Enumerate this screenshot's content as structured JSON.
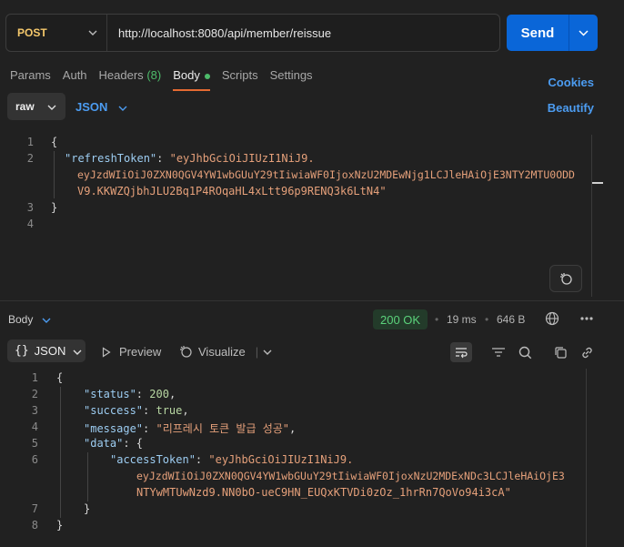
{
  "request": {
    "method": "POST",
    "url": "http://localhost:8080/api/member/reissue",
    "send_label": "Send"
  },
  "tabs": [
    {
      "label": "Params"
    },
    {
      "label": "Auth"
    },
    {
      "label": "Headers",
      "count": "(8)"
    },
    {
      "label": "Body",
      "active": true
    },
    {
      "label": "Scripts"
    },
    {
      "label": "Settings"
    }
  ],
  "links": {
    "cookies": "Cookies",
    "beautify": "Beautify"
  },
  "body_mode": {
    "raw": "raw",
    "json": "JSON"
  },
  "request_body": {
    "line_numbers": [
      "1",
      "2",
      "3",
      "4"
    ],
    "open": "{",
    "key": "\"refreshToken\"",
    "colon": ": ",
    "value_part1": "\"eyJhbGciOiJIUzI1NiJ9.",
    "value_part2": "eyJzdWIiOiJ0ZXN0QGV4YW1wbGUuY29tIiwiaWF0IjoxNzU2MDEwNjg1LCJleHAiOjE3NTY2MTU0ODD",
    "value_part3": "V9.KKWZQjbhJLU2Bq1P4ROqaHL4xLtt96p9RENQ3k6LtN4\"",
    "close": "}"
  },
  "response": {
    "body_label": "Body",
    "status": "200 OK",
    "time": "19 ms",
    "size": "646 B",
    "format": "JSON",
    "preview": "Preview",
    "visualize": "Visualize",
    "line_numbers": [
      "1",
      "2",
      "3",
      "4",
      "5",
      "6",
      "7",
      "8"
    ],
    "status_key": "\"status\"",
    "status_val": "200",
    "success_key": "\"success\"",
    "success_val": "true",
    "message_key": "\"message\"",
    "message_val": "\"리프레시 토큰 발급 성공\"",
    "data_key": "\"data\"",
    "access_key": "\"accessToken\"",
    "access_part1": "\"eyJhbGciOiJIUzI1NiJ9.",
    "access_part2": "eyJzdWIiOiJ0ZXN0QGV4YW1wbGUuY29tIiwiaWF0IjoxNzU2MDExNDc3LCJleHAiOjE3",
    "access_part3": "NTYwMTUwNzd9.NN0bO-ueC9HN_EUQxKTVDi0zOz_1hrRn7QoVo94i3cA\""
  },
  "colors": {
    "accent": "#0a66d8",
    "method": "#f5c86b",
    "status_ok": "#5bd27b",
    "link": "#4c9cf1",
    "tab_indicator": "#e56a32"
  }
}
